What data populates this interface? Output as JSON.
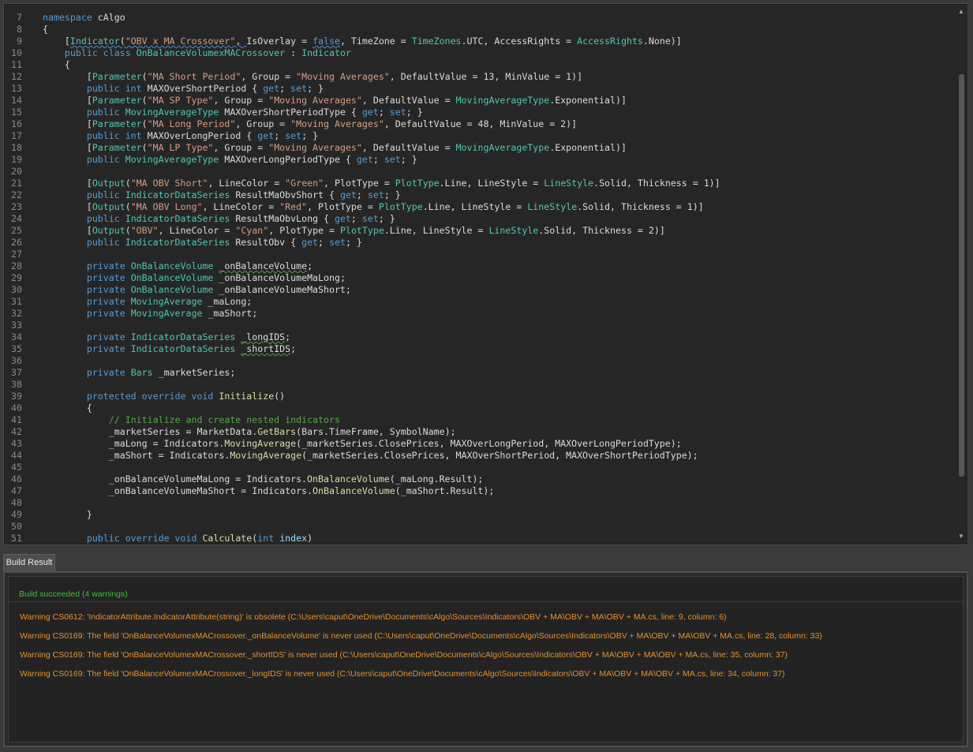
{
  "editor": {
    "lines": [
      {
        "n": "7",
        "h": "<span class=\"kw\">namespace</span> cAlgo"
      },
      {
        "n": "8",
        "h": "{"
      },
      {
        "n": "9",
        "h": "    [<span class=\"ty squig-blue\">Indicator</span><span class=\"squig-blue\">(<span class=\"st\">\"OBV x MA Crossover\"</span>, </span>IsOverlay = <span class=\"kw squig-blue\">false</span>, TimeZone = <span class=\"ty\">TimeZones</span>.UTC, AccessRights = <span class=\"ty\">AccessRights</span>.None)]"
      },
      {
        "n": "10",
        "h": "    <span class=\"kw\">public class</span> <span class=\"ty\">OnBalanceVolumexMACrossover</span> : <span class=\"ty\">Indicator</span>"
      },
      {
        "n": "11",
        "h": "    {"
      },
      {
        "n": "12",
        "h": "        [<span class=\"ty\">Parameter</span>(<span class=\"st\">\"MA Short Period\"</span>, Group = <span class=\"st\">\"Moving Averages\"</span>, DefaultValue = 13, MinValue = 1)]"
      },
      {
        "n": "13",
        "h": "        <span class=\"kw\">public int</span> MAXOverShortPeriod { <span class=\"kw\">get</span>; <span class=\"kw\">set</span>; }"
      },
      {
        "n": "14",
        "h": "        [<span class=\"ty\">Parameter</span>(<span class=\"st\">\"MA SP Type\"</span>, Group = <span class=\"st\">\"Moving Averages\"</span>, DefaultValue = <span class=\"ty\">MovingAverageType</span>.Exponential)]"
      },
      {
        "n": "15",
        "h": "        <span class=\"kw\">public</span> <span class=\"ty\">MovingAverageType</span> MAXOverShortPeriodType { <span class=\"kw\">get</span>; <span class=\"kw\">set</span>; }"
      },
      {
        "n": "16",
        "h": "        [<span class=\"ty\">Parameter</span>(<span class=\"st\">\"MA Long Period\"</span>, Group = <span class=\"st\">\"Moving Averages\"</span>, DefaultValue = 48, MinValue = 2)]"
      },
      {
        "n": "17",
        "h": "        <span class=\"kw\">public int</span> MAXOverLongPeriod { <span class=\"kw\">get</span>; <span class=\"kw\">set</span>; }"
      },
      {
        "n": "18",
        "h": "        [<span class=\"ty\">Parameter</span>(<span class=\"st\">\"MA LP Type\"</span>, Group = <span class=\"st\">\"Moving Averages\"</span>, DefaultValue = <span class=\"ty\">MovingAverageType</span>.Exponential)]"
      },
      {
        "n": "19",
        "h": "        <span class=\"kw\">public</span> <span class=\"ty\">MovingAverageType</span> MAXOverLongPeriodType { <span class=\"kw\">get</span>; <span class=\"kw\">set</span>; }"
      },
      {
        "n": "20",
        "h": ""
      },
      {
        "n": "21",
        "h": "        [<span class=\"ty\">Output</span>(<span class=\"st\">\"MA OBV Short\"</span>, LineColor = <span class=\"st\">\"Green\"</span>, PlotType = <span class=\"ty\">PlotType</span>.Line, LineStyle = <span class=\"ty\">LineStyle</span>.Solid, Thickness = 1)]"
      },
      {
        "n": "22",
        "h": "        <span class=\"kw\">public</span> <span class=\"ty\">IndicatorDataSeries</span> ResultMaObvShort { <span class=\"kw\">get</span>; <span class=\"kw\">set</span>; }"
      },
      {
        "n": "23",
        "h": "        [<span class=\"ty\">Output</span>(<span class=\"st\">\"MA OBV Long\"</span>, LineColor = <span class=\"st\">\"Red\"</span>, PlotType = <span class=\"ty\">PlotType</span>.Line, LineStyle = <span class=\"ty\">LineStyle</span>.Solid, Thickness = 1)]"
      },
      {
        "n": "24",
        "h": "        <span class=\"kw\">public</span> <span class=\"ty\">IndicatorDataSeries</span> ResultMaObvLong { <span class=\"kw\">get</span>; <span class=\"kw\">set</span>; }"
      },
      {
        "n": "25",
        "h": "        [<span class=\"ty\">Output</span>(<span class=\"st\">\"OBV\"</span>, LineColor = <span class=\"st\">\"Cyan\"</span>, PlotType = <span class=\"ty\">PlotType</span>.Line, LineStyle = <span class=\"ty\">LineStyle</span>.Solid, Thickness = 2)]"
      },
      {
        "n": "26",
        "h": "        <span class=\"kw\">public</span> <span class=\"ty\">IndicatorDataSeries</span> ResultObv { <span class=\"kw\">get</span>; <span class=\"kw\">set</span>; }"
      },
      {
        "n": "27",
        "h": ""
      },
      {
        "n": "28",
        "h": "        <span class=\"kw\">private</span> <span class=\"ty\">OnBalanceVolume</span> <span class=\"squig-green\">_onBalanceVolume</span>;"
      },
      {
        "n": "29",
        "h": "        <span class=\"kw\">private</span> <span class=\"ty\">OnBalanceVolume</span> _onBalanceVolumeMaLong;"
      },
      {
        "n": "30",
        "h": "        <span class=\"kw\">private</span> <span class=\"ty\">OnBalanceVolume</span> _onBalanceVolumeMaShort;"
      },
      {
        "n": "31",
        "h": "        <span class=\"kw\">private</span> <span class=\"ty\">MovingAverage</span> _maLong;"
      },
      {
        "n": "32",
        "h": "        <span class=\"kw\">private</span> <span class=\"ty\">MovingAverage</span> _maShort;"
      },
      {
        "n": "33",
        "h": ""
      },
      {
        "n": "34",
        "h": "        <span class=\"kw\">private</span> <span class=\"ty\">IndicatorDataSeries</span> <span class=\"squig-green\">_longIDS</span>;"
      },
      {
        "n": "35",
        "h": "        <span class=\"kw\">private</span> <span class=\"ty\">IndicatorDataSeries</span> <span class=\"squig-green\">_shortIDS</span>;"
      },
      {
        "n": "36",
        "h": ""
      },
      {
        "n": "37",
        "h": "        <span class=\"kw\">private</span> <span class=\"ty\">Bars</span> _marketSeries;"
      },
      {
        "n": "38",
        "h": ""
      },
      {
        "n": "39",
        "h": "        <span class=\"kw\">protected override void</span> <span class=\"mt\">Initialize</span>()"
      },
      {
        "n": "40",
        "h": "        {"
      },
      {
        "n": "41",
        "h": "            <span class=\"co\">// Initialize and create nested indicators</span>"
      },
      {
        "n": "42",
        "h": "            _marketSeries = MarketData.<span class=\"mt\">GetBars</span>(Bars.TimeFrame, SymbolName);"
      },
      {
        "n": "43",
        "h": "            _maLong = Indicators.<span class=\"mt\">MovingAverage</span>(_marketSeries.ClosePrices, MAXOverLongPeriod, MAXOverLongPeriodType);"
      },
      {
        "n": "44",
        "h": "            _maShort = Indicators.<span class=\"mt\">MovingAverage</span>(_marketSeries.ClosePrices, MAXOverShortPeriod, MAXOverShortPeriodType);"
      },
      {
        "n": "45",
        "h": ""
      },
      {
        "n": "46",
        "h": "            _onBalanceVolumeMaLong = Indicators.<span class=\"mt\">OnBalanceVolume</span>(_maLong.Result);"
      },
      {
        "n": "47",
        "h": "            _onBalanceVolumeMaShort = Indicators.<span class=\"mt\">OnBalanceVolume</span>(_maShort.Result);"
      },
      {
        "n": "48",
        "h": ""
      },
      {
        "n": "49",
        "h": "        }"
      },
      {
        "n": "50",
        "h": ""
      },
      {
        "n": "51",
        "h": "        <span class=\"kw\">public override void</span> <span class=\"mt\">Calculate</span>(<span class=\"kw\">int</span> <span class=\"pr\">index</span>)"
      }
    ]
  },
  "scrollbar": {
    "up_icon": "triangle-up",
    "down_icon": "triangle-down",
    "up_glyph": "▲",
    "down_glyph": "▼"
  },
  "panel": {
    "tab_label": "Build Result",
    "status": "Build succeeded (4 warnings)",
    "warnings": [
      "Warning CS0612: 'IndicatorAttribute.IndicatorAttribute(string)' is obsolete (C:\\Users\\caput\\OneDrive\\Documents\\cAlgo\\Sources\\Indicators\\OBV + MA\\OBV + MA\\OBV + MA.cs, line: 9, column: 6)",
      "Warning CS0169: The field 'OnBalanceVolumexMACrossover._onBalanceVolume' is never used (C:\\Users\\caput\\OneDrive\\Documents\\cAlgo\\Sources\\Indicators\\OBV + MA\\OBV + MA\\OBV + MA.cs, line: 28, column: 33)",
      "Warning CS0169: The field 'OnBalanceVolumexMACrossover._shortIDS' is never used (C:\\Users\\caput\\OneDrive\\Documents\\cAlgo\\Sources\\Indicators\\OBV + MA\\OBV + MA\\OBV + MA.cs, line: 35, column: 37)",
      "Warning CS0169: The field 'OnBalanceVolumexMACrossover._longIDS' is never used (C:\\Users\\caput\\OneDrive\\Documents\\cAlgo\\Sources\\Indicators\\OBV + MA\\OBV + MA\\OBV + MA.cs, line: 34, column: 37)"
    ]
  },
  "colors": {
    "success": "#3cbf3c",
    "warning": "#e8902a",
    "background": "#262626"
  }
}
